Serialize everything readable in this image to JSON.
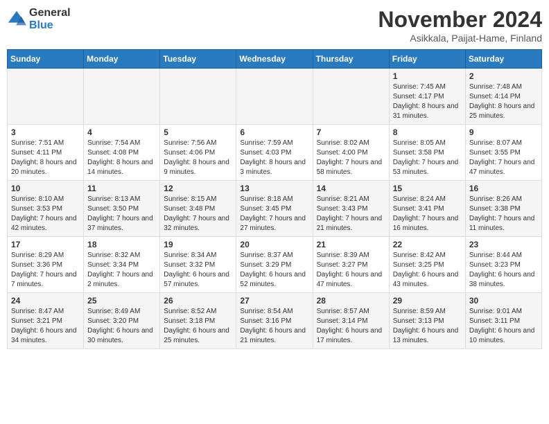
{
  "logo": {
    "general": "General",
    "blue": "Blue"
  },
  "title": "November 2024",
  "subtitle": "Asikkala, Paijat-Hame, Finland",
  "weekdays": [
    "Sunday",
    "Monday",
    "Tuesday",
    "Wednesday",
    "Thursday",
    "Friday",
    "Saturday"
  ],
  "weeks": [
    [
      {
        "day": "",
        "sunrise": "",
        "sunset": "",
        "daylight": ""
      },
      {
        "day": "",
        "sunrise": "",
        "sunset": "",
        "daylight": ""
      },
      {
        "day": "",
        "sunrise": "",
        "sunset": "",
        "daylight": ""
      },
      {
        "day": "",
        "sunrise": "",
        "sunset": "",
        "daylight": ""
      },
      {
        "day": "",
        "sunrise": "",
        "sunset": "",
        "daylight": ""
      },
      {
        "day": "1",
        "sunrise": "Sunrise: 7:45 AM",
        "sunset": "Sunset: 4:17 PM",
        "daylight": "Daylight: 8 hours and 31 minutes."
      },
      {
        "day": "2",
        "sunrise": "Sunrise: 7:48 AM",
        "sunset": "Sunset: 4:14 PM",
        "daylight": "Daylight: 8 hours and 25 minutes."
      }
    ],
    [
      {
        "day": "3",
        "sunrise": "Sunrise: 7:51 AM",
        "sunset": "Sunset: 4:11 PM",
        "daylight": "Daylight: 8 hours and 20 minutes."
      },
      {
        "day": "4",
        "sunrise": "Sunrise: 7:54 AM",
        "sunset": "Sunset: 4:08 PM",
        "daylight": "Daylight: 8 hours and 14 minutes."
      },
      {
        "day": "5",
        "sunrise": "Sunrise: 7:56 AM",
        "sunset": "Sunset: 4:06 PM",
        "daylight": "Daylight: 8 hours and 9 minutes."
      },
      {
        "day": "6",
        "sunrise": "Sunrise: 7:59 AM",
        "sunset": "Sunset: 4:03 PM",
        "daylight": "Daylight: 8 hours and 3 minutes."
      },
      {
        "day": "7",
        "sunrise": "Sunrise: 8:02 AM",
        "sunset": "Sunset: 4:00 PM",
        "daylight": "Daylight: 7 hours and 58 minutes."
      },
      {
        "day": "8",
        "sunrise": "Sunrise: 8:05 AM",
        "sunset": "Sunset: 3:58 PM",
        "daylight": "Daylight: 7 hours and 53 minutes."
      },
      {
        "day": "9",
        "sunrise": "Sunrise: 8:07 AM",
        "sunset": "Sunset: 3:55 PM",
        "daylight": "Daylight: 7 hours and 47 minutes."
      }
    ],
    [
      {
        "day": "10",
        "sunrise": "Sunrise: 8:10 AM",
        "sunset": "Sunset: 3:53 PM",
        "daylight": "Daylight: 7 hours and 42 minutes."
      },
      {
        "day": "11",
        "sunrise": "Sunrise: 8:13 AM",
        "sunset": "Sunset: 3:50 PM",
        "daylight": "Daylight: 7 hours and 37 minutes."
      },
      {
        "day": "12",
        "sunrise": "Sunrise: 8:15 AM",
        "sunset": "Sunset: 3:48 PM",
        "daylight": "Daylight: 7 hours and 32 minutes."
      },
      {
        "day": "13",
        "sunrise": "Sunrise: 8:18 AM",
        "sunset": "Sunset: 3:45 PM",
        "daylight": "Daylight: 7 hours and 27 minutes."
      },
      {
        "day": "14",
        "sunrise": "Sunrise: 8:21 AM",
        "sunset": "Sunset: 3:43 PM",
        "daylight": "Daylight: 7 hours and 21 minutes."
      },
      {
        "day": "15",
        "sunrise": "Sunrise: 8:24 AM",
        "sunset": "Sunset: 3:41 PM",
        "daylight": "Daylight: 7 hours and 16 minutes."
      },
      {
        "day": "16",
        "sunrise": "Sunrise: 8:26 AM",
        "sunset": "Sunset: 3:38 PM",
        "daylight": "Daylight: 7 hours and 11 minutes."
      }
    ],
    [
      {
        "day": "17",
        "sunrise": "Sunrise: 8:29 AM",
        "sunset": "Sunset: 3:36 PM",
        "daylight": "Daylight: 7 hours and 7 minutes."
      },
      {
        "day": "18",
        "sunrise": "Sunrise: 8:32 AM",
        "sunset": "Sunset: 3:34 PM",
        "daylight": "Daylight: 7 hours and 2 minutes."
      },
      {
        "day": "19",
        "sunrise": "Sunrise: 8:34 AM",
        "sunset": "Sunset: 3:32 PM",
        "daylight": "Daylight: 6 hours and 57 minutes."
      },
      {
        "day": "20",
        "sunrise": "Sunrise: 8:37 AM",
        "sunset": "Sunset: 3:29 PM",
        "daylight": "Daylight: 6 hours and 52 minutes."
      },
      {
        "day": "21",
        "sunrise": "Sunrise: 8:39 AM",
        "sunset": "Sunset: 3:27 PM",
        "daylight": "Daylight: 6 hours and 47 minutes."
      },
      {
        "day": "22",
        "sunrise": "Sunrise: 8:42 AM",
        "sunset": "Sunset: 3:25 PM",
        "daylight": "Daylight: 6 hours and 43 minutes."
      },
      {
        "day": "23",
        "sunrise": "Sunrise: 8:44 AM",
        "sunset": "Sunset: 3:23 PM",
        "daylight": "Daylight: 6 hours and 38 minutes."
      }
    ],
    [
      {
        "day": "24",
        "sunrise": "Sunrise: 8:47 AM",
        "sunset": "Sunset: 3:21 PM",
        "daylight": "Daylight: 6 hours and 34 minutes."
      },
      {
        "day": "25",
        "sunrise": "Sunrise: 8:49 AM",
        "sunset": "Sunset: 3:20 PM",
        "daylight": "Daylight: 6 hours and 30 minutes."
      },
      {
        "day": "26",
        "sunrise": "Sunrise: 8:52 AM",
        "sunset": "Sunset: 3:18 PM",
        "daylight": "Daylight: 6 hours and 25 minutes."
      },
      {
        "day": "27",
        "sunrise": "Sunrise: 8:54 AM",
        "sunset": "Sunset: 3:16 PM",
        "daylight": "Daylight: 6 hours and 21 minutes."
      },
      {
        "day": "28",
        "sunrise": "Sunrise: 8:57 AM",
        "sunset": "Sunset: 3:14 PM",
        "daylight": "Daylight: 6 hours and 17 minutes."
      },
      {
        "day": "29",
        "sunrise": "Sunrise: 8:59 AM",
        "sunset": "Sunset: 3:13 PM",
        "daylight": "Daylight: 6 hours and 13 minutes."
      },
      {
        "day": "30",
        "sunrise": "Sunrise: 9:01 AM",
        "sunset": "Sunset: 3:11 PM",
        "daylight": "Daylight: 6 hours and 10 minutes."
      }
    ]
  ]
}
